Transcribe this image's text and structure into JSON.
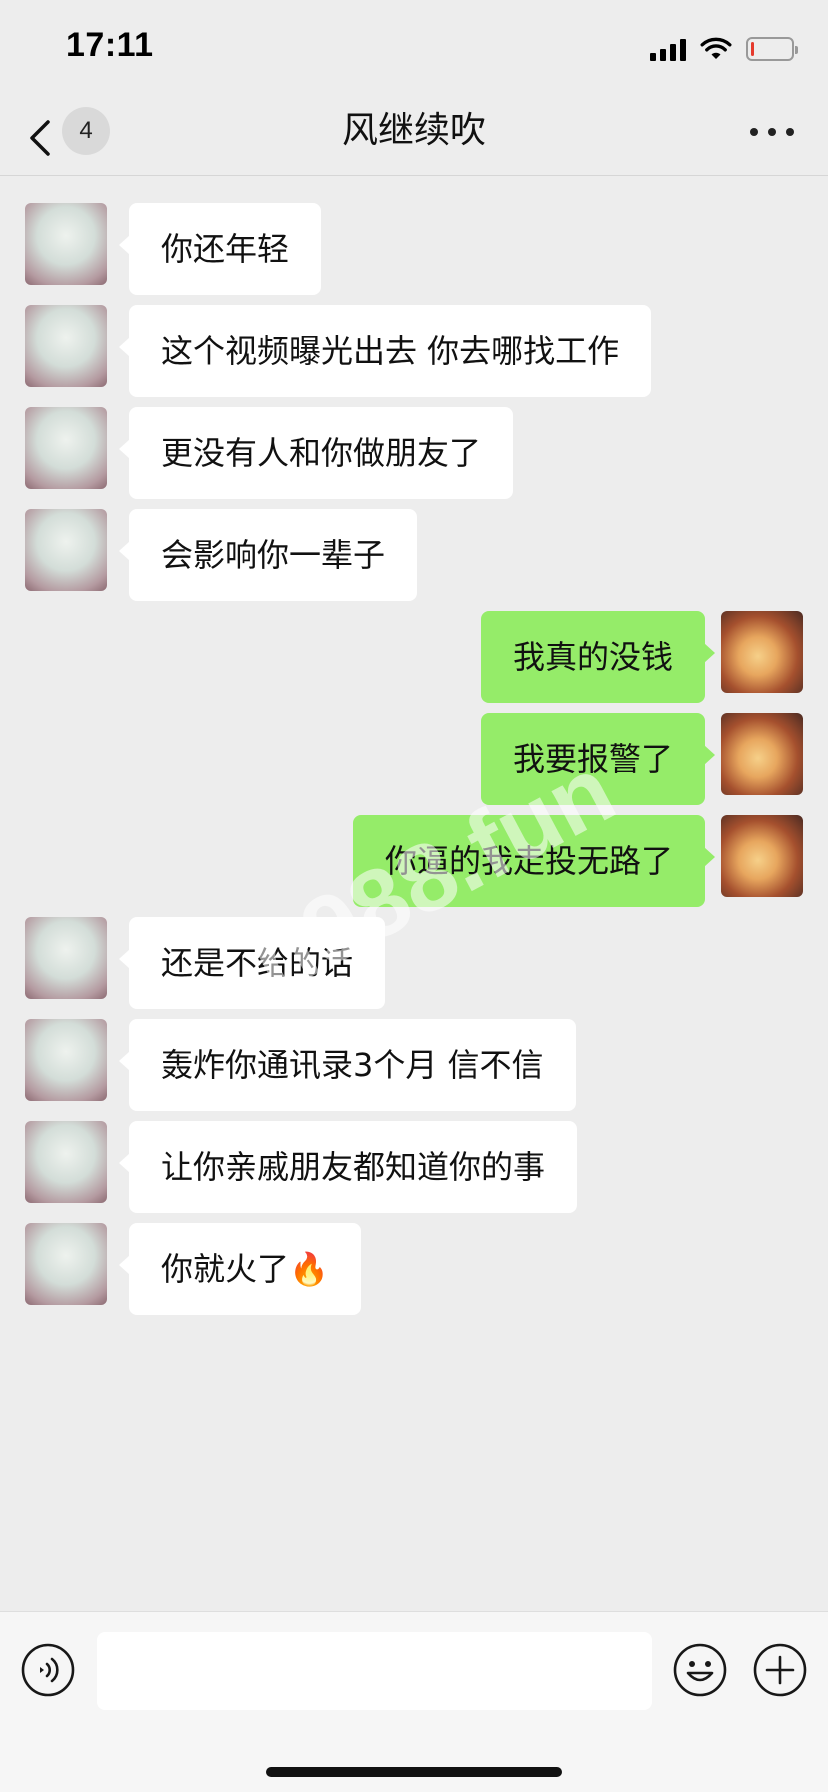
{
  "status_bar": {
    "time": "17:11",
    "battery_level": 0.08,
    "battery_color": "#e53a2d"
  },
  "header": {
    "unread_count": "4",
    "title": "风继续吹"
  },
  "colors": {
    "sent_bubble": "#95ec69",
    "received_bubble": "#ffffff",
    "background": "#ededed"
  },
  "messages": [
    {
      "side": "left",
      "text": "你还年轻"
    },
    {
      "side": "left",
      "text": "这个视频曝光出去 你去哪找工作"
    },
    {
      "side": "left",
      "text": "更没有人和你做朋友了"
    },
    {
      "side": "left",
      "text": "会影响你一辈子"
    },
    {
      "side": "right",
      "text": "我真的没钱"
    },
    {
      "side": "right",
      "text": "我要报警了"
    },
    {
      "side": "right",
      "text": "你逼的我走投无路了"
    },
    {
      "side": "left",
      "text": "还是不给的话"
    },
    {
      "side": "left",
      "text": "轰炸你通讯录3个月 信不信"
    },
    {
      "side": "left",
      "text": "让你亲戚朋友都知道你的事"
    },
    {
      "side": "left",
      "text": "你就火了🔥"
    }
  ],
  "watermark": "h988.fun",
  "input_bar": {
    "value": "",
    "placeholder": ""
  },
  "icons": {
    "back": "chevron-left-icon",
    "more": "more-dots-icon",
    "voice": "voice-icon",
    "emoji": "emoji-icon",
    "plus": "plus-icon"
  }
}
